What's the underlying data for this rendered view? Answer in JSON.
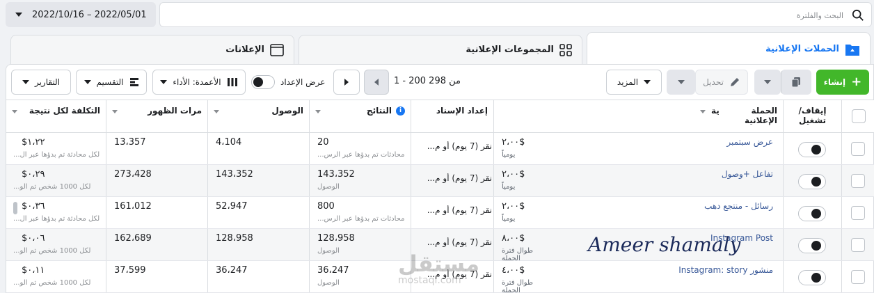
{
  "search": {
    "placeholder": "البحث والفلترة"
  },
  "date_range": "2022/10/16 – 2022/05/01",
  "tabs": [
    {
      "label": "الحملات الإعلانية",
      "icon": "folder-icon"
    },
    {
      "label": "المجموعات الإعلانية",
      "icon": "grid-icon"
    },
    {
      "label": "الإعلانات",
      "icon": "ad-icon"
    }
  ],
  "toolbar": {
    "create": "إنشاء",
    "edit": "تحديل",
    "more": "المزيد",
    "range": "1 - 200 من 298",
    "setup_view": "عرض الإعداد",
    "columns": "الأعمدة: الأداء",
    "breakdown": "التقسيم",
    "reports": "التقارير"
  },
  "headers": {
    "onoff": "إيقاف/ تشغيل",
    "campaign": "الحملة الإعلانية",
    "budget": "ية",
    "attribution": "إعداد الإسناد",
    "results": "النتائج",
    "reach": "الوصول",
    "impressions": "مرات الظهور",
    "cost": "التكلفة لكل نتيجة"
  },
  "rows": [
    {
      "campaign": "عرض سبتمبر",
      "budget": "$٢،٠٠",
      "budget_sub": "يومياً",
      "attribution": "نقر (7 يوم) أو م...",
      "results": "20",
      "results_sub": "محادثات تم بدؤها عبر الرس...",
      "reach": "4،104",
      "impressions": "13،357",
      "cost": "$١،٢٢",
      "cost_sub": "لكل محادثة تم بدؤها عبر ال..."
    },
    {
      "campaign": "تفاعل +وصول",
      "budget": "$٢،٠٠",
      "budget_sub": "يومياً",
      "attribution": "نقر (7 يوم) أو م...",
      "results": "143،352",
      "results_sub": "الوصول",
      "reach": "143،352",
      "impressions": "273،428",
      "cost": "$٠،٢٩",
      "cost_sub": "لكل 1000 شخص تم الو..."
    },
    {
      "campaign": "رسائل - منتجع دهب",
      "budget": "$٢،٠٠",
      "budget_sub": "يومياً",
      "attribution": "نقر (7 يوم) أو م...",
      "results": "800",
      "results_sub": "محادثات تم بدؤها عبر الرس...",
      "reach": "52،947",
      "impressions": "161،012",
      "cost": "$٠،٣٦",
      "cost_sub": "لكل محادثة تم بدؤها عبر ال..."
    },
    {
      "campaign": "Instagram Post",
      "budget": "$٨،٠٠",
      "budget_sub": "طوال فترة الحملة",
      "attribution": "نقر (7 يوم) أو م...",
      "results": "128،958",
      "results_sub": "الوصول",
      "reach": "128،958",
      "impressions": "162،689",
      "cost": "$٠،٠٦",
      "cost_sub": "لكل 1000 شخص تم الو..."
    },
    {
      "campaign": "منشور Instagram: story",
      "budget": "$٤،٠٠",
      "budget_sub": "طوال فترة الحملة",
      "attribution": "نقر (7 يوم) أو م...",
      "results": "36،247",
      "results_sub": "الوصول",
      "reach": "36،247",
      "impressions": "37،599",
      "cost": "$٠،١١",
      "cost_sub": "لكل 1000 شخص تم الو..."
    }
  ],
  "watermark": "Ameer shamaly",
  "logo": "مستقل",
  "logo_sub": "mostaql.com"
}
